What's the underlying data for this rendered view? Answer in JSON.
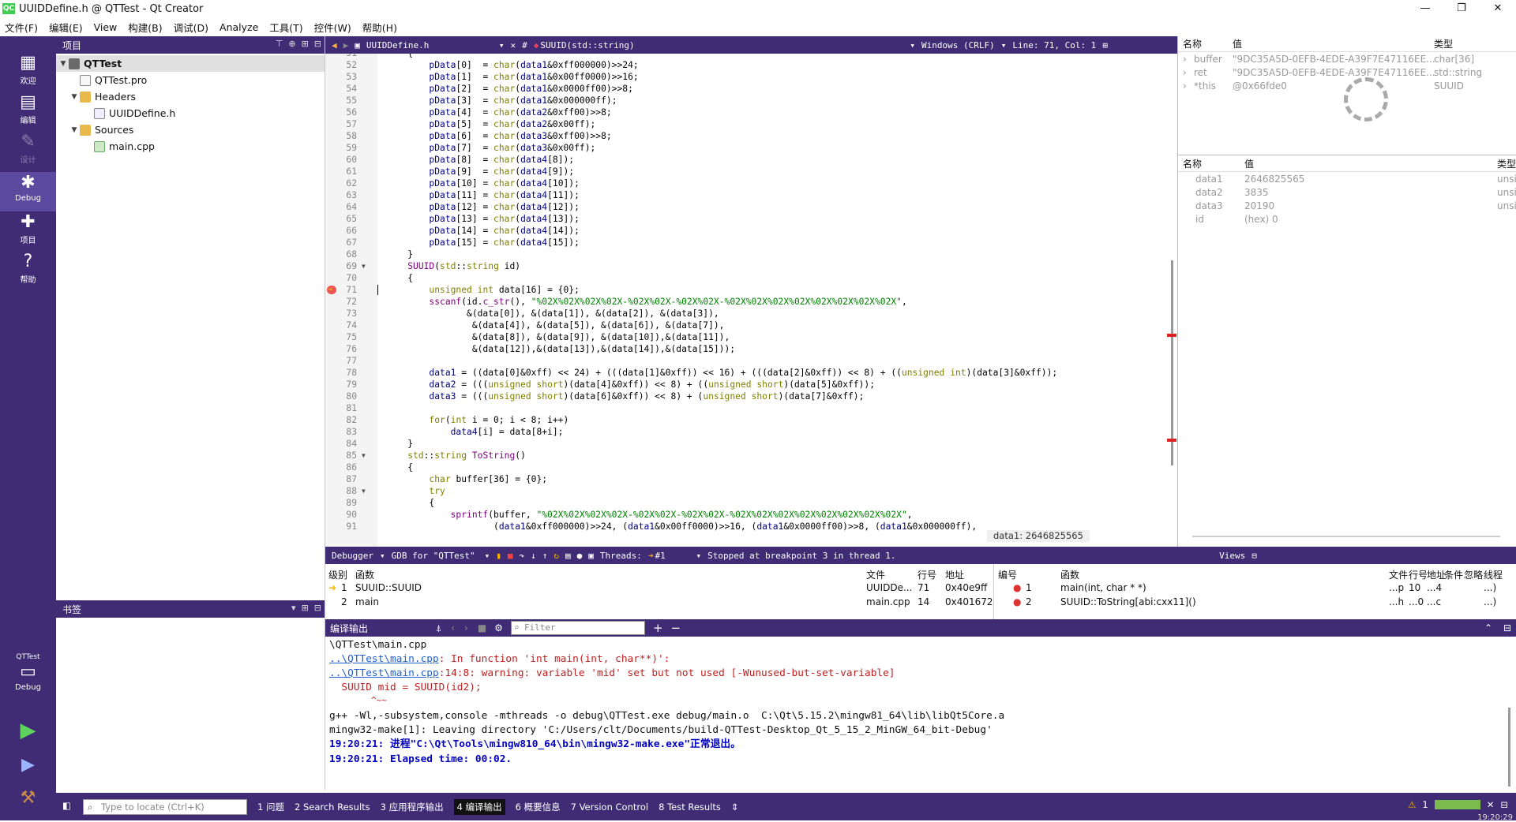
{
  "window": {
    "title": "UUIDDefine.h @ QTTest - Qt Creator",
    "logo": "QC",
    "controls": [
      "—",
      "❐",
      "✕"
    ]
  },
  "menu": [
    "文件(F)",
    "编辑(E)",
    "View",
    "构建(B)",
    "调试(D)",
    "Analyze",
    "工具(T)",
    "控件(W)",
    "帮助(H)"
  ],
  "modes": [
    {
      "label": "欢迎",
      "icon": "grid-icon"
    },
    {
      "label": "编辑",
      "icon": "edit-icon"
    },
    {
      "label": "设计",
      "icon": "pen-icon"
    },
    {
      "label": "Debug",
      "icon": "bug-icon"
    },
    {
      "label": "项目",
      "icon": "wrench-icon"
    },
    {
      "label": "帮助",
      "icon": "help-icon"
    }
  ],
  "kit": {
    "project": "QTTest",
    "config": "Debug"
  },
  "project_pane": {
    "title": "项目",
    "tree": [
      {
        "label": "QTTest",
        "level": 0,
        "kind": "proj",
        "expanded": true,
        "selected": true
      },
      {
        "label": "QTTest.pro",
        "level": 1,
        "kind": "pro"
      },
      {
        "label": "Headers",
        "level": 1,
        "kind": "folder",
        "expanded": true
      },
      {
        "label": "UUIDDefine.h",
        "level": 2,
        "kind": "h"
      },
      {
        "label": "Sources",
        "level": 1,
        "kind": "folder",
        "expanded": true
      },
      {
        "label": "main.cpp",
        "level": 2,
        "kind": "cpp"
      }
    ]
  },
  "bookmarks": {
    "title": "书签"
  },
  "editor": {
    "file": "UUIDDefine.h",
    "hash": "#",
    "symbol": "SUUID(std::string)",
    "encoding": "Windows (CRLF)",
    "position": "Line: 71, Col: 1",
    "breakpoint_line": 71,
    "lines": [
      {
        "n": 51,
        "code": "    {"
      },
      {
        "n": 52,
        "code": "        pData[0]  = char(data1&0xff000000)>>24;"
      },
      {
        "n": 53,
        "code": "        pData[1]  = char(data1&0x00ff0000)>>16;"
      },
      {
        "n": 54,
        "code": "        pData[2]  = char(data1&0x0000ff00)>>8;"
      },
      {
        "n": 55,
        "code": "        pData[3]  = char(data1&0x000000ff);"
      },
      {
        "n": 56,
        "code": "        pData[4]  = char(data2&0xff00)>>8;"
      },
      {
        "n": 57,
        "code": "        pData[5]  = char(data2&0x00ff);"
      },
      {
        "n": 58,
        "code": "        pData[6]  = char(data3&0xff00)>>8;"
      },
      {
        "n": 59,
        "code": "        pData[7]  = char(data3&0x00ff);"
      },
      {
        "n": 60,
        "code": "        pData[8]  = char(data4[8]);"
      },
      {
        "n": 61,
        "code": "        pData[9]  = char(data4[9]);"
      },
      {
        "n": 62,
        "code": "        pData[10] = char(data4[10]);"
      },
      {
        "n": 63,
        "code": "        pData[11] = char(data4[11]);"
      },
      {
        "n": 64,
        "code": "        pData[12] = char(data4[12]);"
      },
      {
        "n": 65,
        "code": "        pData[13] = char(data4[13]);"
      },
      {
        "n": 66,
        "code": "        pData[14] = char(data4[14]);"
      },
      {
        "n": 67,
        "code": "        pData[15] = char(data4[15]);"
      },
      {
        "n": 68,
        "code": "    }"
      },
      {
        "n": 69,
        "code": "    SUUID(std::string id)",
        "fold": true
      },
      {
        "n": 70,
        "code": "    {"
      },
      {
        "n": 71,
        "code": "        unsigned int data[16] = {0};",
        "bp": true
      },
      {
        "n": 72,
        "code": "        sscanf(id.c_str(), \"%02X%02X%02X%02X-%02X%02X-%02X%02X-%02X%02X%02X%02X%02X%02X%02X%02X\","
      },
      {
        "n": 73,
        "code": "               &(data[0]), &(data[1]), &(data[2]), &(data[3]),"
      },
      {
        "n": 74,
        "code": "                &(data[4]), &(data[5]), &(data[6]), &(data[7]),"
      },
      {
        "n": 75,
        "code": "                &(data[8]), &(data[9]), &(data[10]),&(data[11]),"
      },
      {
        "n": 76,
        "code": "                &(data[12]),&(data[13]),&(data[14]),&(data[15]));"
      },
      {
        "n": 77,
        "code": ""
      },
      {
        "n": 78,
        "code": "        data1 = ((data[0]&0xff) << 24) + (((data[1]&0xff)) << 16) + (((data[2]&0xff)) << 8) + ((unsigned int)(data[3]&0xff));"
      },
      {
        "n": 79,
        "code": "        data2 = (((unsigned short)(data[4]&0xff)) << 8) + ((unsigned short)(data[5]&0xff));"
      },
      {
        "n": 80,
        "code": "        data3 = (((unsigned short)(data[6]&0xff)) << 8) + (unsigned short)(data[7]&0xff);"
      },
      {
        "n": 81,
        "code": ""
      },
      {
        "n": 82,
        "code": "        for(int i = 0; i < 8; i++)"
      },
      {
        "n": 83,
        "code": "            data4[i] = data[8+i];"
      },
      {
        "n": 84,
        "code": "    }"
      },
      {
        "n": 85,
        "code": "    std::string ToString()",
        "fold": true
      },
      {
        "n": 86,
        "code": "    {"
      },
      {
        "n": 87,
        "code": "        char buffer[36] = {0};"
      },
      {
        "n": 88,
        "code": "        try",
        "fold": true
      },
      {
        "n": 89,
        "code": "        {"
      },
      {
        "n": 90,
        "code": "            sprintf(buffer, \"%02X%02X%02X%02X-%02X%02X-%02X%02X-%02X%02X%02X%02X%02X%02X%02X%02X\","
      },
      {
        "n": 91,
        "code": "                    (data1&0xff000000)>>24, (data1&0x00ff0000)>>16, (data1&0x0000ff00)>>8, (data1&0x000000ff),"
      }
    ],
    "tooltip": "data1: 2646825565"
  },
  "locals": {
    "headers": [
      "名称",
      "值",
      "类型"
    ],
    "rows": [
      {
        "name": "buffer",
        "value": "\"9DC35A5D-0EFB-4EDE-A39F7E47116EE...",
        "type": "char[36]"
      },
      {
        "name": "ret",
        "value": "\"9DC35A5D-0EFB-4EDE-A39F7E47116EE...",
        "type": "std::string"
      },
      {
        "name": "*this",
        "value": "@0x66fde0",
        "type": "SUUID"
      }
    ]
  },
  "expressions": {
    "headers": [
      "名称",
      "值",
      "类型"
    ],
    "rows": [
      {
        "name": "data1",
        "value": "2646825565",
        "type": "unsi"
      },
      {
        "name": "data2",
        "value": "3835",
        "type": "unsi"
      },
      {
        "name": "data3",
        "value": "20190",
        "type": "unsi"
      },
      {
        "name": "id",
        "value": "(hex) 0",
        "type": ""
      }
    ]
  },
  "debugger": {
    "engine": "Debugger",
    "gdb": "GDB for \"QTTest\"",
    "threads_label": "Threads:",
    "thread": "#1",
    "status": "Stopped at breakpoint 3 in thread 1.",
    "views": "Views"
  },
  "stack": {
    "headers": [
      "级别",
      "函数",
      "文件",
      "行号",
      "地址"
    ],
    "rows": [
      {
        "level": "1",
        "func": "SUUID::SUUID",
        "file": "UUIDDe...",
        "line": "71",
        "addr": "0x40e9ff"
      },
      {
        "level": "2",
        "func": "main",
        "file": "main.cpp",
        "line": "14",
        "addr": "0x401672"
      }
    ]
  },
  "breakpoints": {
    "headers": [
      "编号",
      "函数",
      "文件",
      "行号",
      "地址",
      "条件",
      "忽略",
      "线程"
    ],
    "rows": [
      {
        "num": "1",
        "func": "main(int, char * *)",
        "file": "...p",
        "line": "10",
        "addr": "...4",
        "thread": "...)"
      },
      {
        "num": "2",
        "func": "SUUID::ToString[abi:cxx11]()",
        "file": "...h",
        "line": "...0",
        "addr": "...c",
        "thread": "...)"
      }
    ]
  },
  "output": {
    "title": "编译输出",
    "filter_placeholder": "Filter",
    "lines": [
      {
        "text": "\\QTTest\\main.cpp",
        "cls": ""
      },
      {
        "link": "..\\QTTest\\main.cpp",
        "text": ": In function 'int main(int, char**)':",
        "cls": "o-red"
      },
      {
        "link": "..\\QTTest\\main.cpp",
        "text": ":14:8: warning: variable 'mid' set but not used [-Wunused-but-set-variable]",
        "cls": "o-red"
      },
      {
        "text": "  SUUID mid = SUUID(id2);",
        "cls": "o-red"
      },
      {
        "text": "        ^~~",
        "cls": "o-red"
      },
      {
        "text": "g++ -Wl,-subsystem,console -mthreads -o debug\\QTTest.exe debug/main.o  C:\\Qt\\5.15.2\\mingw81_64\\lib\\libQt5Core.a",
        "cls": ""
      },
      {
        "text": "mingw32-make[1]: Leaving directory 'C:/Users/clt/Documents/build-QTTest-Desktop_Qt_5_15_2_MinGW_64_bit-Debug'",
        "cls": ""
      },
      {
        "text": "19:20:21: 进程\"C:\\Qt\\Tools\\mingw810_64\\bin\\mingw32-make.exe\"正常退出。",
        "cls": "o-blue"
      },
      {
        "text": "19:20:21: Elapsed time: 00:02.",
        "cls": "o-blue"
      }
    ]
  },
  "statusbar": {
    "locator_placeholder": "Type to locate (Ctrl+K)",
    "tabs": [
      "1 问题",
      "2 Search Results",
      "3 应用程序输出",
      "4 编译输出",
      "6 概要信息",
      "7 Version Control",
      "8 Test Results"
    ],
    "active_tab": 3,
    "warning_count": "1",
    "clock": "19:20:29"
  }
}
